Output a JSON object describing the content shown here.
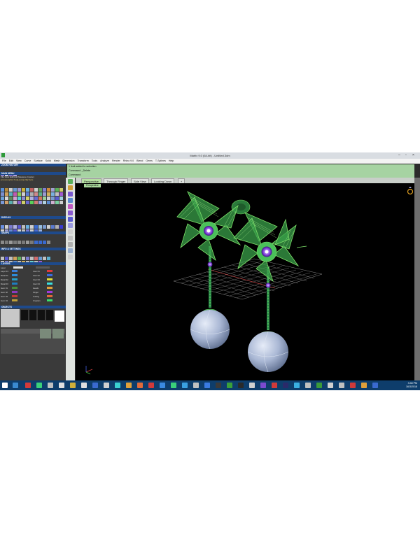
{
  "window": {
    "title": "Matrix 9.0 (64-bit) - Untitled.3dm"
  },
  "menu": [
    "File",
    "Edit",
    "View",
    "Curve",
    "Surface",
    "Solid",
    "Mesh",
    "Dimension",
    "Transform",
    "Tools",
    "Analyze",
    "Render",
    "Rhino 9.0",
    "Blend",
    "Gems",
    "T-Splines",
    "Help"
  ],
  "panels": {
    "history": "ZOOM HISTORY",
    "main_menu": "MAIN MENU",
    "main_menu_items": "File  View  Edit/Add  Measure  Custom",
    "main_menu_row2": "▸Custom▸Std.Tool▸Lock▸Util▸Tools",
    "display": "DISPLAY",
    "snaps": "SNAPS",
    "info": "INFO & SETTINGS",
    "layers": "LAYERS",
    "layer_header": "Layer",
    "objects": "OBJECTS"
  },
  "layers": [
    {
      "name": "Layer 01",
      "color": "#3a7dd6"
    },
    {
      "name": "Metal 01",
      "color": "#2e8bd8"
    },
    {
      "name": "Metal 02",
      "color": "#27a0c8"
    },
    {
      "name": "Metal 03",
      "color": "#1d7fc0"
    },
    {
      "name": "Gem 01",
      "color": "#4a8f3a"
    },
    {
      "name": "Gem 02",
      "color": "#8a3ac0"
    },
    {
      "name": "Gem 03",
      "color": "#c03a3a"
    },
    {
      "name": "Gem 04",
      "color": "#c0a03a"
    }
  ],
  "layers_right": [
    "User 01",
    "User 02",
    "User 03",
    "User 04",
    "Heads",
    "Finger",
    "Cutting",
    "Creation"
  ],
  "command": {
    "line1": "1 limit added to selection",
    "line2": "Command: _Delete",
    "line3": "Command:"
  },
  "viewport_tabs": [
    "Perspective",
    "Through Finger",
    "Side View",
    "Looking Down",
    "+"
  ],
  "viewport_label": "Perspective",
  "clock": {
    "time": "3:48 PM",
    "date": "16/3/2018"
  },
  "colors": {
    "accent_green": "#7ee06a",
    "gem_purple": "#8a4ae0",
    "sphere": "#aab8d4"
  }
}
